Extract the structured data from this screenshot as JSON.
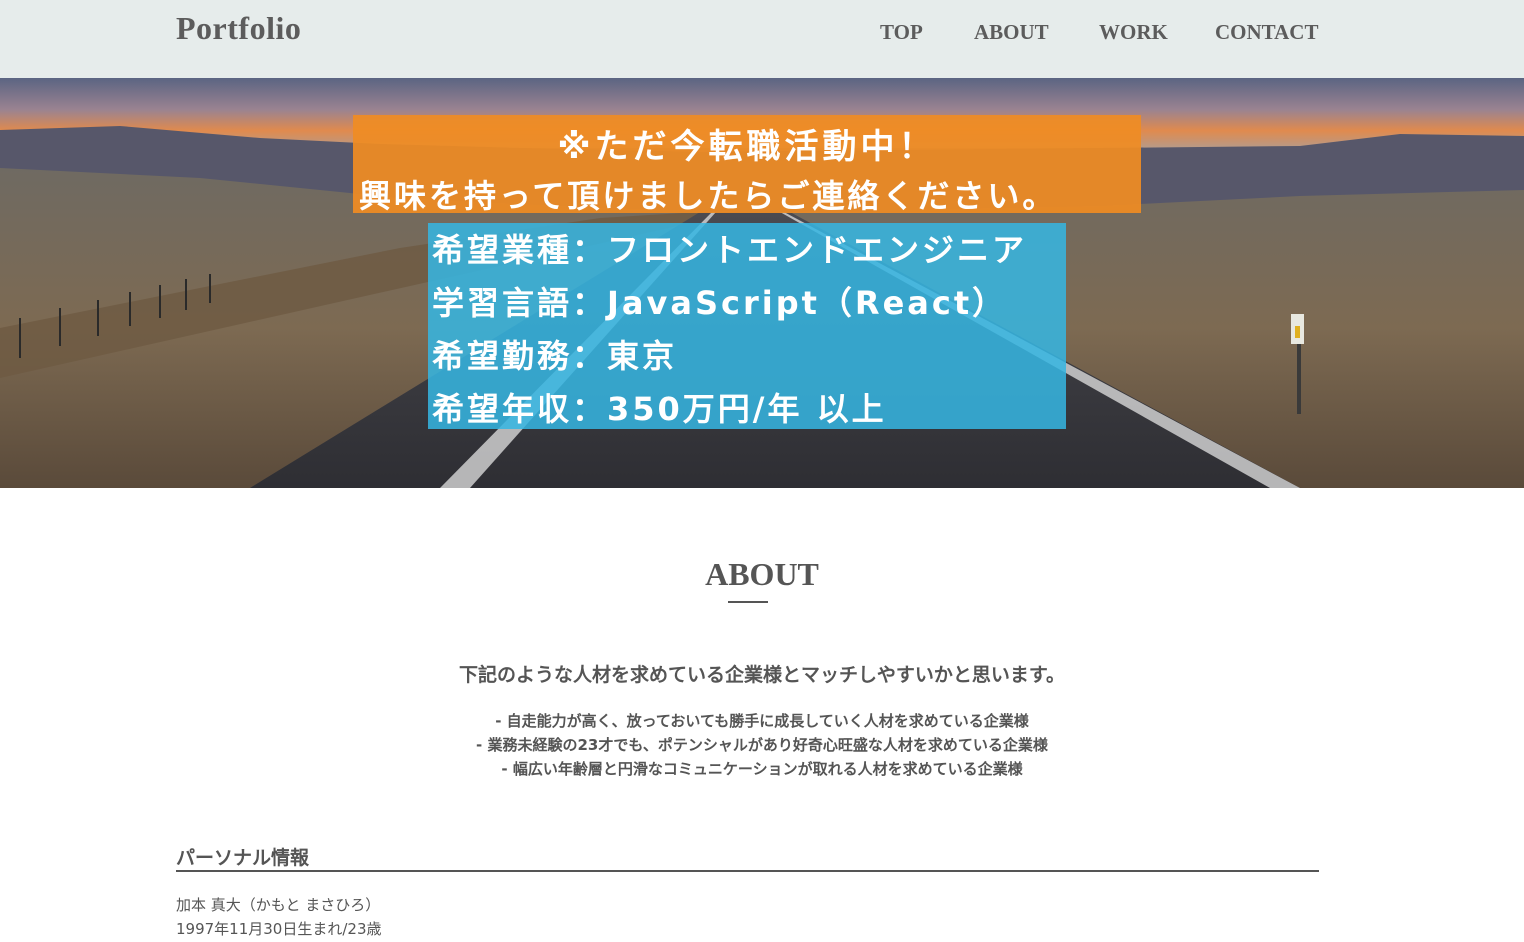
{
  "header": {
    "logo": "Portfolio",
    "nav": [
      "TOP",
      "ABOUT",
      "WORK",
      "CONTACT"
    ]
  },
  "hero": {
    "image": "road-at-sunset",
    "banner_orange": {
      "line1": "※ただ今転職活動中！",
      "line2": "興味を持って頂けましたらご連絡ください。",
      "color": "#ef8c23"
    },
    "banner_blue": {
      "lines": [
        "希望業種：フロントエンドエンジニア",
        "学習言語：JavaScript（React）",
        "希望勤務：東京",
        "希望年収：350万円/年 以上"
      ],
      "color": "#35b6e2"
    }
  },
  "about": {
    "title": "ABOUT",
    "lead": "下記のような人材を求めている企業様とマッチしやすいかと思います。",
    "bullets": [
      "- 自走能力が高く、放っておいても勝手に成長していく人材を求めている企業様",
      "- 業務未経験の23才でも、ポテンシャルがあり好奇心旺盛な人材を求めている企業様",
      "- 幅広い年齢層と円滑なコミュニケーションが取れる人材を求めている企業様"
    ]
  },
  "personal": {
    "heading": "パーソナル情報",
    "name": "加本 真大（かもと まさひろ）",
    "birth": "1997年11月30日生まれ/23歳"
  },
  "colors": {
    "header_bg": "#e6eceb",
    "text": "#555555"
  }
}
